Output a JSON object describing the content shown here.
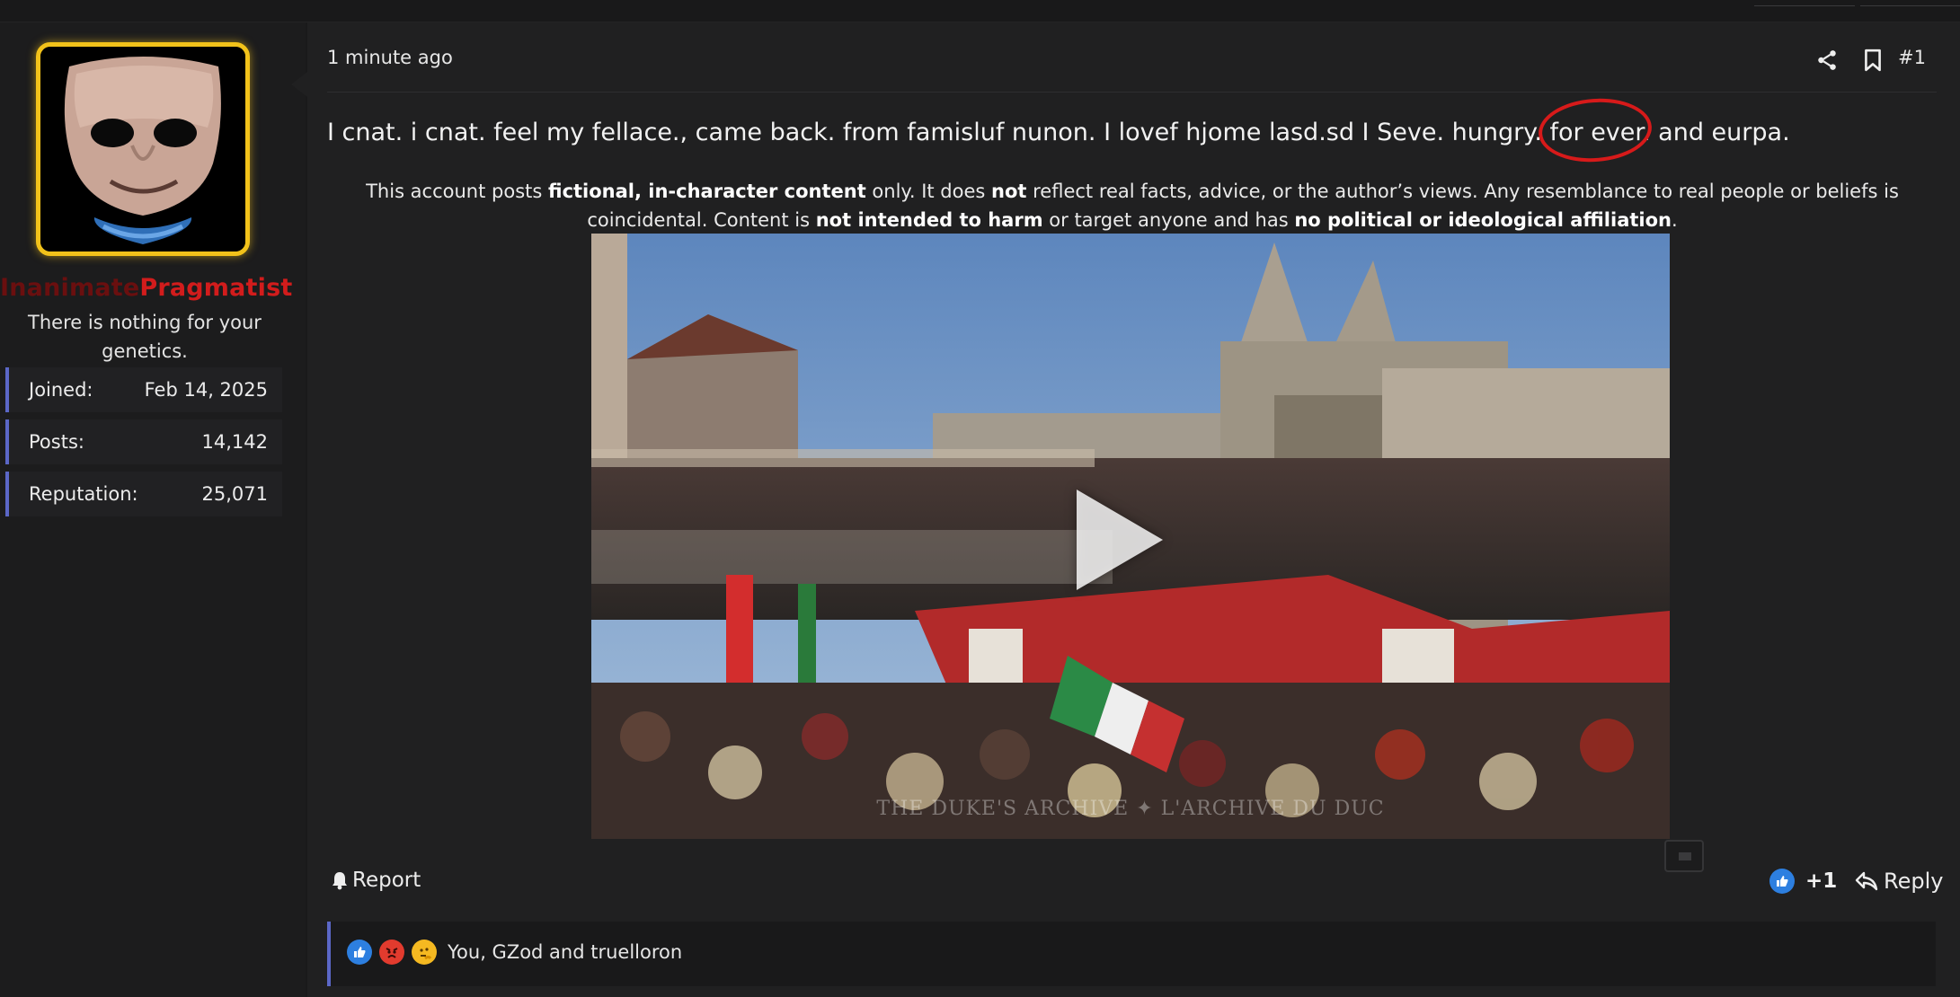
{
  "user": {
    "name_part1": "Inanimate",
    "name_part2": "Pragmatist",
    "title": "There is nothing for your genetics.",
    "stats": [
      {
        "label": "Joined:",
        "value": "Feb 14, 2025"
      },
      {
        "label": "Posts:",
        "value": "14,142"
      },
      {
        "label": "Reputation:",
        "value": "25,071"
      }
    ]
  },
  "post": {
    "time": "1 minute ago",
    "number": "#1",
    "message": "I cnat. i cnat. feel my fellace., came back. from famisluf nunon. I lovef hjome lasd.sd I Seve. hungry. for ever. and eurpa.",
    "disclaimer": {
      "t1": "This account posts ",
      "b1": "fictional, in-character content",
      "t2": " only. It does ",
      "b2": "not",
      "t3": " reflect real facts, advice, or the author’s views. Any resemblance to real people or beliefs is coincidental. Content is ",
      "b3": "not intended to harm",
      "t4": " or target anyone and has ",
      "b4": "no political or ideological affiliation",
      "t5": "."
    },
    "video_watermark": "THE DUKE'S ARCHIVE ✦ L'ARCHIVE DU DUC"
  },
  "actions": {
    "report_label": "Report",
    "reaction_count": "+1",
    "reply_label": "Reply"
  },
  "reactions": {
    "summary": "You, GZod and truelloron",
    "icons": [
      "like-icon",
      "angry-icon",
      "thinking-icon"
    ]
  },
  "colors": {
    "accent": "#5b67c7",
    "avatar_border": "#f2c21a",
    "name_dark": "#6a0f0f",
    "name_red": "#d21c1c",
    "annotation": "#d71a1a"
  }
}
